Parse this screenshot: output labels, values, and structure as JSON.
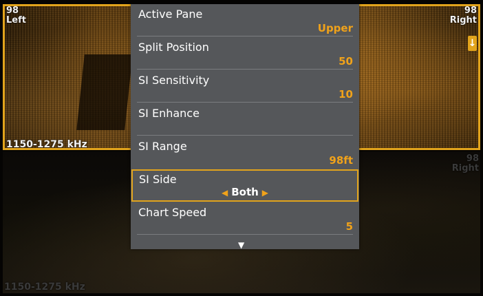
{
  "upper_pane": {
    "left_label_range": "98",
    "left_label_side": "Left",
    "right_label_range": "98",
    "right_label_side": "Right",
    "frequency": "1150-1275 kHz"
  },
  "lower_pane": {
    "right_label_range": "98",
    "right_label_side": "Right",
    "frequency": "1150-1275 kHz"
  },
  "menu": {
    "items": [
      {
        "label": "Active Pane",
        "value": "Upper"
      },
      {
        "label": "Split Position",
        "value": "50"
      },
      {
        "label": "SI Sensitivity",
        "value": "10"
      },
      {
        "label": "SI Enhance",
        "value": ""
      },
      {
        "label": "SI Range",
        "value": "98ft"
      },
      {
        "label": "SI Side",
        "value": "Both"
      },
      {
        "label": "Chart Speed",
        "value": "5"
      }
    ]
  },
  "colors": {
    "accent": "#e2a41c",
    "menu_bg": "#55575a",
    "value_text": "#f0a21a"
  },
  "icons": {
    "down_arrow": "down-arrow-icon",
    "left_arrow": "left-triangle-icon",
    "right_arrow": "right-triangle-icon",
    "more_arrow": "down-triangle-icon"
  }
}
